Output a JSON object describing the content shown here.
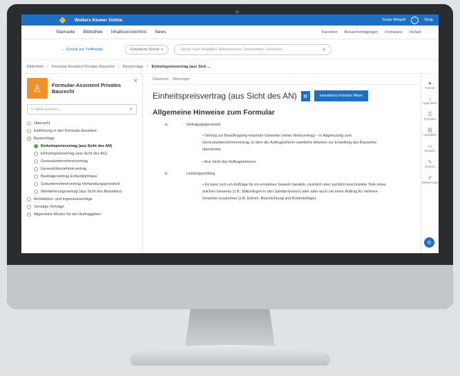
{
  "topbar": {
    "brand": "Wolters Kluwer Online",
    "user": "Sonja Weigelt",
    "shop": "Shop"
  },
  "nav": {
    "items": [
      "Startseite",
      "Bibliothek",
      "Inhaltsverzeichnis",
      "News"
    ],
    "right": [
      "Favoriten",
      "Benachrichtigungen",
      "Formulare",
      "Verlauf"
    ]
  },
  "search": {
    "back": "← Zurück zur Trefferliste",
    "advanced": "Erweiterte Suche ∨",
    "placeholder": "Suche nach Begriffen, Aktenzeichen, Vorschriften, Gerichten ..."
  },
  "breadcrumb": [
    "Bibliothek",
    "Formular-Assistent Privates Baurecht",
    "Bauverträge",
    "Einheitspreisvertrag (aus Sich ..."
  ],
  "sidebar": {
    "title": "Formular-Assistent Privates Baurecht",
    "search_placeholder": "In Werk suchen ...",
    "items": [
      {
        "label": "Übersicht",
        "sub": false,
        "state": ""
      },
      {
        "label": "Einführung in den Formular-Assistent",
        "sub": false,
        "state": ""
      },
      {
        "label": "Bauverträge",
        "sub": false,
        "state": "open"
      },
      {
        "label": "Einheitspreisvertrag (aus Sicht des AN)",
        "sub": true,
        "state": "on"
      },
      {
        "label": "Einheitspreisvertrag (aus Sicht des AG)",
        "sub": true,
        "state": ""
      },
      {
        "label": "Generalunternehmervertrag",
        "sub": true,
        "state": ""
      },
      {
        "label": "Generalübernehmervertrag",
        "sub": true,
        "state": ""
      },
      {
        "label": "Bauträgervertrag Einfamilienhaus",
        "sub": true,
        "state": ""
      },
      {
        "label": "Subunternehmervertrag Verhandlungsprotokoll",
        "sub": true,
        "state": ""
      },
      {
        "label": "Werklieferungsvertrag (aus Sicht des Bestellers)",
        "sub": true,
        "state": ""
      },
      {
        "label": "Architekten- und Ingenieurverträge",
        "sub": false,
        "state": ""
      },
      {
        "label": "Sonstige Verträge",
        "sub": false,
        "state": ""
      },
      {
        "label": "Allgemeine Muster für den Auftraggeber",
        "sub": false,
        "state": ""
      }
    ]
  },
  "doc": {
    "tabs": [
      "Dokument",
      "Zitierungen"
    ],
    "title": "Einheitspreisvertrag (aus Sicht des AN)",
    "form_button": "Interaktives Formular öffnen",
    "section": "Allgemeine Hinweise zum Formular",
    "a_label": "a.",
    "a_text": "Vertragsgegenstand",
    "bullet1": "Vertrag zur Beauftragung einzelner Gewerke (reiner Werkvertrag) – in Abgrenzung zum Generalunternehmervertrag, in dem der Auftragnehmer sämtliche Arbeiten zur Erstellung des Bauwerks übernimmt.",
    "bullet2": "Aus Sicht des Auftragnehmers",
    "b_label": "b.",
    "b_text": "Leistungsumfang",
    "bullet3": "Es kann sich um Aufträge für ein einzelnes Gewerk handeln, räumlich oder sachlich beschränkte Teile eines solchen Gewerks (z.B. Silikonfugen in den Sanitärräumen) oder aber auch um einen Auftrag für mehrere Gewerke zusammen (z.B. Estrich, Beschichtung und Bodenbeläge)."
  },
  "rail": [
    "Favorit",
    "Speichern",
    "Drucken",
    "Direktlink",
    "Dossier",
    "Notizen",
    "Markierung"
  ]
}
